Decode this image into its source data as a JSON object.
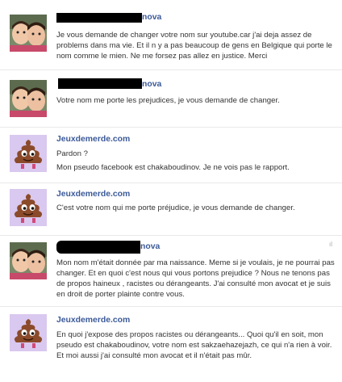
{
  "messages": [
    {
      "sender": "nova",
      "lines": [
        "Je vous demande de changer votre nom sur youtube.car j'ai deja assez de problems dans ma vie. Et il n y a pas beaucoup de gens en Belgique qui porte le nom comme le mien. Ne me forsez pas allez en justice. Merci"
      ]
    },
    {
      "sender": "nova",
      "lines": [
        "Votre nom me porte les prejudices, je vous demande de changer."
      ]
    },
    {
      "sender": "Jeuxdemerde.com",
      "lines": [
        "Pardon ?",
        "Mon pseudo facebook est chakaboudinov. Je ne vois pas le rapport."
      ]
    },
    {
      "sender": "Jeuxdemerde.com",
      "lines": [
        "C'est votre nom qui me porte préjudice, je vous demande de changer."
      ]
    },
    {
      "sender": "nova",
      "lines": [
        "Mon nom m'était donnée par ma naissance. Meme si je voulais, je ne pourrai pas changer. Et en quoi c'est nous qui vous portons prejudice ? Nous ne tenons pas de propos haineux , racistes ou dérangeants. J'ai consulté mon avocat et je suis en droit de porter plainte contre vous."
      ]
    },
    {
      "sender": "Jeuxdemerde.com",
      "lines": [
        "En quoi j'expose des propos racistes ou dérangeants... Quoi qu'il en soit, mon pseudo est chakaboudinov, votre nom est sakzaehazejazh, ce qui n'a rien à voir.",
        "Et moi aussi j'ai consulté mon avocat et il n'était pas mûr."
      ]
    }
  ],
  "colors": {
    "link_blue": "#3b5998",
    "text": "#333333",
    "separator": "#e9e9e9",
    "redaction": "#000000",
    "avatar_bg_purple": "#d9c8ef",
    "poop_brown": "#8b4b2b"
  },
  "icons": {
    "child_avatar": "photo-avatar",
    "poop_avatar": "poop-character-avatar"
  }
}
